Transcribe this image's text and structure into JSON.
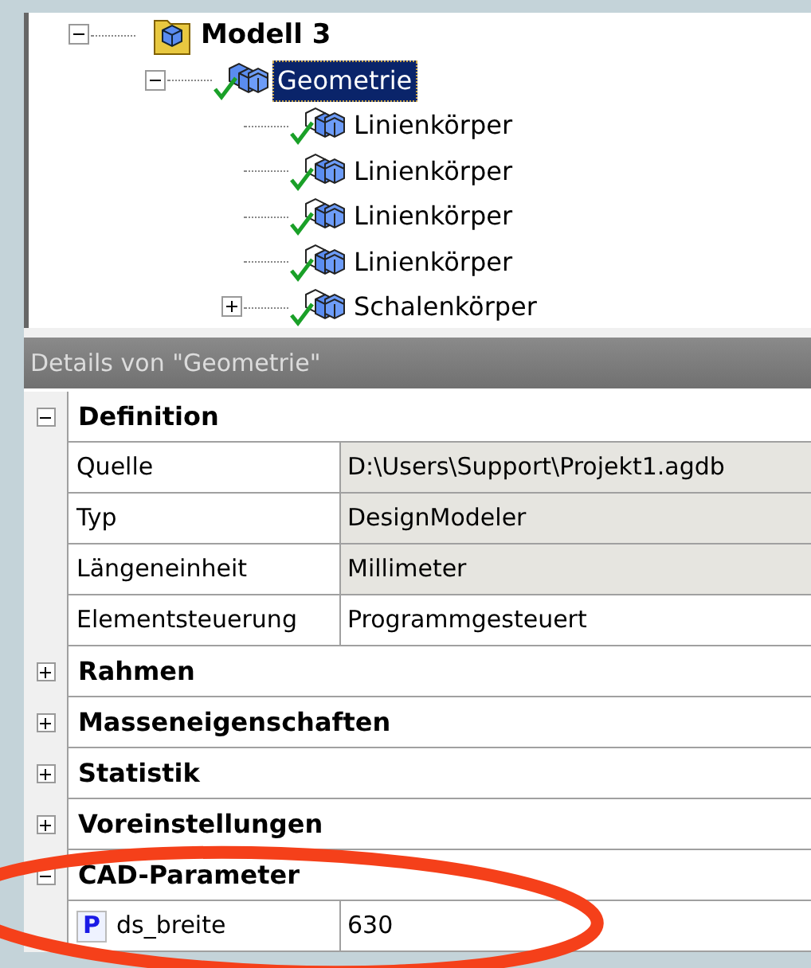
{
  "tree": [
    {
      "label": "Modell 3",
      "kind": "model",
      "expanded": true,
      "checked": false,
      "selected": false,
      "children": [
        {
          "label": "Geometrie",
          "kind": "geometry",
          "expanded": true,
          "checked": true,
          "selected": true,
          "children": [
            {
              "label": "Linienkörper",
              "kind": "body",
              "checked": true,
              "selected": false
            },
            {
              "label": "Linienkörper",
              "kind": "body",
              "checked": true,
              "selected": false
            },
            {
              "label": "Linienkörper",
              "kind": "body",
              "checked": true,
              "selected": false
            },
            {
              "label": "Linienkörper",
              "kind": "body",
              "checked": true,
              "selected": false
            },
            {
              "label": "Schalenkörper",
              "kind": "body",
              "expanded": false,
              "checked": true,
              "selected": false
            }
          ]
        }
      ]
    }
  ],
  "details": {
    "title": "Details von \"Geometrie\"",
    "groups": [
      {
        "title": "Definition",
        "expanded": true,
        "rows": [
          {
            "name": "Quelle",
            "value": "D:\\Users\\Support\\Projekt1.agdb",
            "readonly": true
          },
          {
            "name": "Typ",
            "value": "DesignModeler",
            "readonly": true
          },
          {
            "name": "Längeneinheit",
            "value": "Millimeter",
            "readonly": true
          },
          {
            "name": "Elementsteuerung",
            "value": "Programmgesteuert",
            "readonly": false
          }
        ]
      },
      {
        "title": "Rahmen",
        "expanded": false
      },
      {
        "title": "Masseneigenschaften",
        "expanded": false
      },
      {
        "title": "Statistik",
        "expanded": false
      },
      {
        "title": "Voreinstellungen",
        "expanded": false
      },
      {
        "title": "CAD-Parameter",
        "expanded": true,
        "rows": [
          {
            "name": "ds_breite",
            "value": "630",
            "readonly": false,
            "badge": "P"
          }
        ]
      }
    ]
  },
  "highlight": {
    "color": "#f5401a"
  }
}
